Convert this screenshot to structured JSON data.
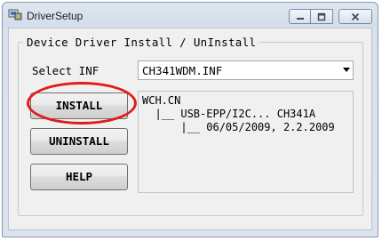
{
  "window": {
    "title": "DriverSetup",
    "icon": "driver-setup-icon",
    "controls": {
      "minimize": "minimize-icon",
      "maximize": "maximize-icon",
      "close": "close-icon"
    }
  },
  "group": {
    "label": "Device Driver Install / UnInstall"
  },
  "inf": {
    "label": "Select INF",
    "selected": "CH341WDM.INF"
  },
  "buttons": {
    "install": "INSTALL",
    "uninstall": "UNINSTALL",
    "help": "HELP"
  },
  "info": {
    "line1": "WCH.CN",
    "line2": "  |__ USB-EPP/I2C... CH341A",
    "line3": "      |__ 06/05/2009, 2.2.2009"
  },
  "annotation": {
    "color": "#e21b1b"
  }
}
